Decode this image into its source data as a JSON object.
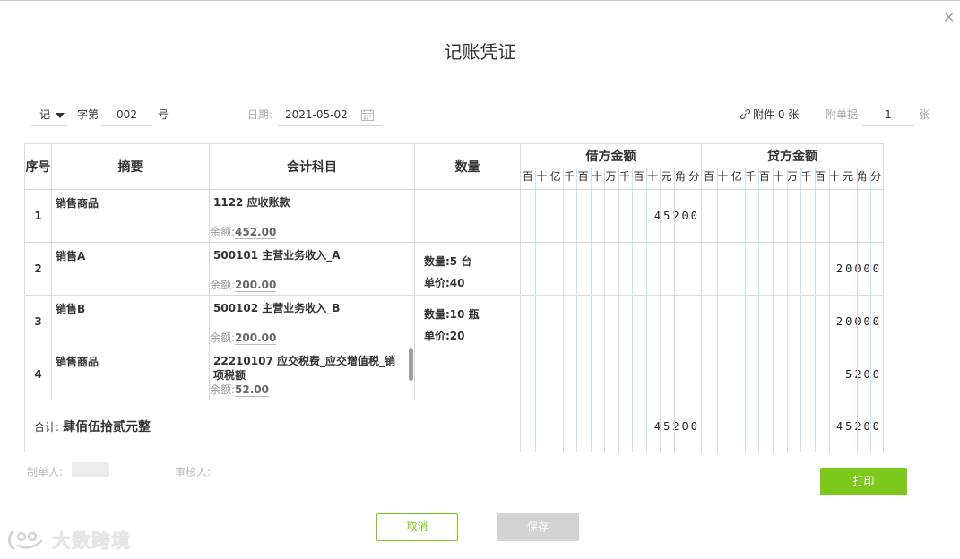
{
  "dialog": {
    "title": "记账凭证",
    "close_icon": "×"
  },
  "header": {
    "voucher_word": "记",
    "zi_di": "字第",
    "voucher_number": "002",
    "hao": "号",
    "date_label": "日期:",
    "date_value": "2021-05-02",
    "attachment_label": "附件 0 张",
    "bill_label": "附单据",
    "bill_count": "1",
    "zhang": "张"
  },
  "table": {
    "headers": {
      "index": "序号",
      "summary": "摘要",
      "account": "会计科目",
      "quantity": "数量",
      "debit": "借方金额",
      "credit": "贷方金额"
    },
    "digit_units": [
      "百",
      "十",
      "亿",
      "千",
      "百",
      "十",
      "万",
      "千",
      "百",
      "十",
      "元",
      "角",
      "分"
    ],
    "rows": [
      {
        "index": "1",
        "summary": "销售商品",
        "account": "1122 应收账款",
        "balance_label": "余额:",
        "balance": "452.00",
        "qty_text": "",
        "price_text": "",
        "debit": "45200",
        "credit": ""
      },
      {
        "index": "2",
        "summary": "销售A",
        "account": "500101 主营业务收入_A",
        "balance_label": "余额:",
        "balance": "200.00",
        "qty_text": "数量:5 台",
        "price_text": "单价:40",
        "debit": "",
        "credit": "20000"
      },
      {
        "index": "3",
        "summary": "销售B",
        "account": "500102 主营业务收入_B",
        "balance_label": "余额:",
        "balance": "200.00",
        "qty_text": "数量:10 瓶",
        "price_text": "单价:20",
        "debit": "",
        "credit": "20000"
      },
      {
        "index": "4",
        "summary": "销售商品",
        "account": "22210107 应交税费_应交增值税_销项税额",
        "balance_label": "余额:",
        "balance": "52.00",
        "qty_text": "",
        "price_text": "",
        "debit": "",
        "credit": "5200"
      }
    ],
    "total": {
      "label": "合计:",
      "text": "肆佰伍拾贰元整",
      "debit": "45200",
      "credit": "45200"
    }
  },
  "footer": {
    "maker_label": "制单人:",
    "reviewer_label": "审核人:"
  },
  "buttons": {
    "print": "打印",
    "cancel": "取消",
    "save": "保存"
  },
  "watermark": {
    "text": "大数跨境"
  },
  "colors": {
    "accent": "#7cc81c",
    "save_disabled": "#d3d3d3",
    "grid_blue": "#c9e2f5",
    "grid_red": "#f4cccc"
  }
}
